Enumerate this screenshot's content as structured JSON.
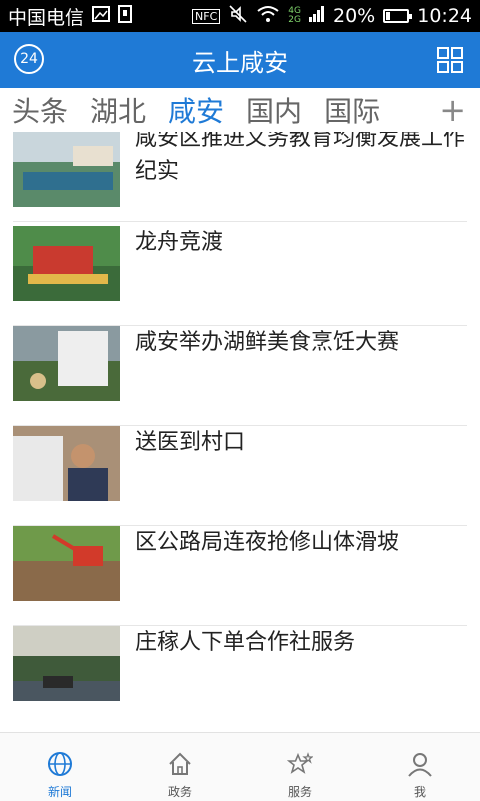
{
  "status_bar": {
    "carrier": "中国电信",
    "nfc": "NFC",
    "net_top": "4G",
    "net_bottom": "2G",
    "battery_percent": "20%",
    "battery_level": 0.2,
    "time": "10:24"
  },
  "header": {
    "title": "云上咸安",
    "badge": "24",
    "accent_color": "#1f7ad6"
  },
  "tabs": [
    {
      "label": "头条"
    },
    {
      "label": "湖北"
    },
    {
      "label": "咸安"
    },
    {
      "label": "国内"
    },
    {
      "label": "国际"
    }
  ],
  "tabs_add": "+",
  "active_tab": "咸安",
  "news": [
    {
      "title": "咸安区推进义务教育均衡发展工作纪实"
    },
    {
      "title": "龙舟竞渡"
    },
    {
      "title": "咸安举办湖鲜美食烹饪大赛"
    },
    {
      "title": "送医到村口"
    },
    {
      "title": "区公路局连夜抢修山体滑坡"
    },
    {
      "title": "庄稼人下单合作社服务"
    }
  ],
  "bottom_nav": [
    {
      "label": "新闻",
      "icon": "globe-icon"
    },
    {
      "label": "政务",
      "icon": "home-icon"
    },
    {
      "label": "服务",
      "icon": "stars-icon"
    },
    {
      "label": "我",
      "icon": "user-icon"
    }
  ]
}
